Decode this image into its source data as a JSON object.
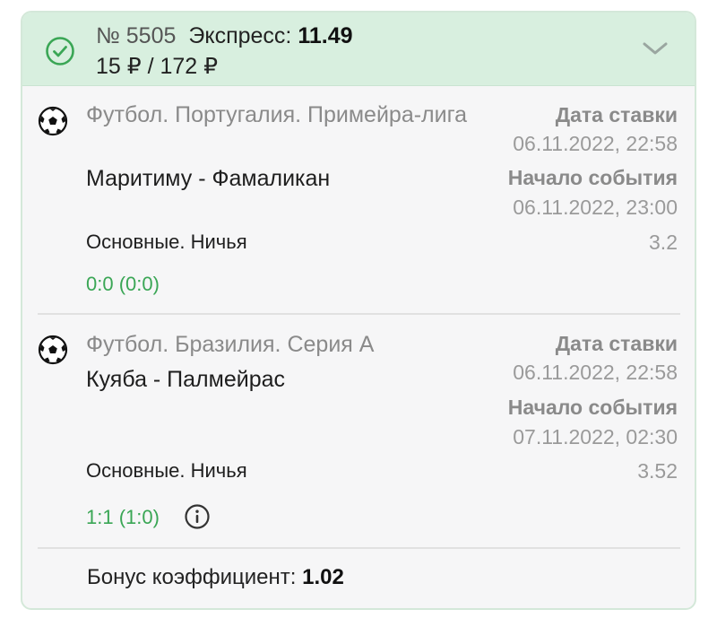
{
  "bet": {
    "number": "№ 5505",
    "type": "Экспресс:",
    "coefficient": "11.49",
    "stake_payout": "15 ₽ / 172 ₽",
    "status_icon": "check-circle-icon",
    "expand_icon": "chevron-down-icon",
    "accent_color": "#3aa655",
    "header_bg": "#d8efdf"
  },
  "events": [
    {
      "sport_icon": "soccer-ball-icon",
      "league": "Футбол. Португалия. Примейра-лига",
      "teams": "Маритиму - Фамаликан",
      "market": "Основные. Ничья",
      "score": "0:0 (0:0)",
      "bet_date_label": "Дата ставки",
      "bet_date": "06.11.2022, 22:58",
      "event_start_label": "Начало события",
      "event_start": "06.11.2022, 23:00",
      "odds": "3.2"
    },
    {
      "sport_icon": "soccer-ball-icon",
      "league": "Футбол. Бразилия. Серия A",
      "teams": "Куяба - Палмейрас",
      "market": "Основные. Ничья",
      "score": "1:1 (1:0)",
      "bet_date_label": "Дата ставки",
      "bet_date": "06.11.2022, 22:58",
      "event_start_label": "Начало события",
      "event_start": "07.11.2022, 02:30",
      "odds": "3.52",
      "info_icon": "info-icon"
    }
  ],
  "bonus": {
    "label": "Бонус коэффициент: ",
    "value": "1.02"
  }
}
